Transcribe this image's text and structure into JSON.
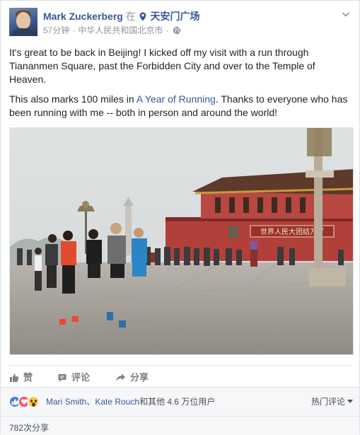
{
  "post": {
    "author": "Mark Zuckerberg",
    "at_word": "在",
    "place": "天安门广场",
    "time": "57分钟",
    "separator": "·",
    "location": "中华人民共和国北京市",
    "dot": "·",
    "privacy_icon": "globe-icon",
    "paragraph1": "It's great to be back in Beijing! I kicked off my visit with a run through Tiananmen Square, past the Forbidden City and over to the Temple of Heaven.",
    "p2_before": "This also marks 100 miles in ",
    "p2_link": "A Year of Running",
    "p2_after": ". Thanks to everyone who has been running with me -- both in person and around the world!",
    "photo_sign": "世界人民大团结万岁"
  },
  "actions": {
    "like": "赞",
    "comment": "评论",
    "share": "分享"
  },
  "summary": {
    "liker1": "Mari Smith",
    "joiner": "、",
    "liker2": "Kate Rouch",
    "rest": "和其他 4.6 万位用户",
    "sort_label": "热门评论",
    "share_count": "782次分享"
  },
  "colors": {
    "link": "#365899",
    "meta": "#90949c",
    "like": "#4a7bd8",
    "love": "#f25268",
    "wow": "#fbcd4d"
  }
}
